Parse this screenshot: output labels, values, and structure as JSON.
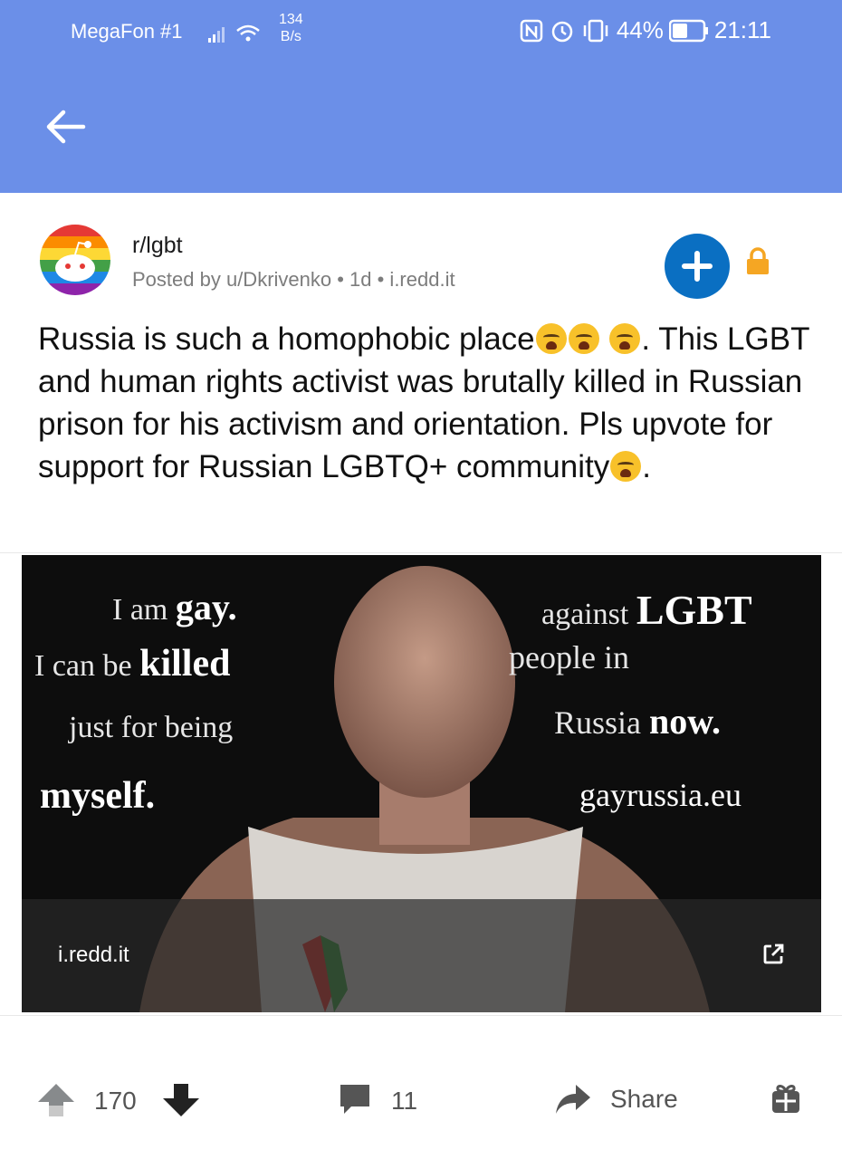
{
  "status_bar": {
    "carrier": "MegaFon #1",
    "speed_value": "134",
    "speed_unit": "B/s",
    "battery": "44%",
    "time": "21:11"
  },
  "post": {
    "subreddit": "r/lgbt",
    "meta": "Posted by u/Dkrivenko • 1d • i.redd.it",
    "title_parts": [
      "Russia is such a homophobic place",
      ". This LGBT and human rights activist was brutally killed in Russian prison for his activism and orientation. Pls upvote for support for Russian LGBTQ+ community",
      "."
    ],
    "image": {
      "left_lines": [
        "I am",
        "gay.",
        "I can be",
        "killed",
        "just for being",
        "myself."
      ],
      "right_lines": [
        "against",
        "LGBT",
        "people in",
        "Russia",
        "now.",
        "gayrussia.eu"
      ],
      "link_domain": "i.redd.it"
    },
    "actions": {
      "upvotes": "170",
      "comments": "11",
      "share_label": "Share"
    }
  },
  "colors": {
    "header": "#6b8fe8",
    "join": "#0a6fc2",
    "lock": "#f5a623"
  },
  "icons": [
    "back-arrow-icon",
    "join-plus-icon",
    "lock-icon",
    "upvote-icon",
    "downvote-icon",
    "comment-icon",
    "share-icon",
    "award-icon",
    "external-link-icon"
  ]
}
